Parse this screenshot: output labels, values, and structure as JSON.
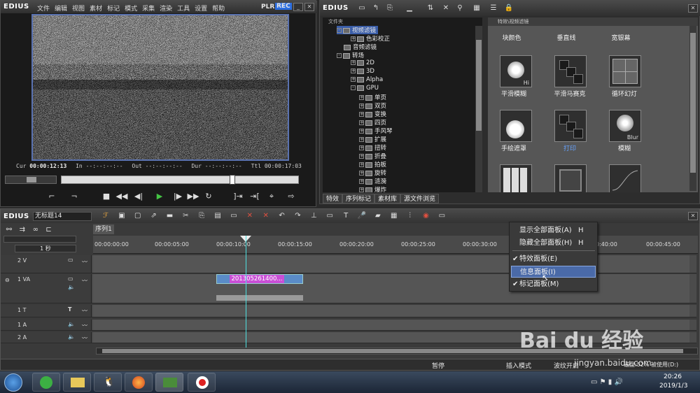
{
  "player": {
    "logo": "EDIUS",
    "menu": [
      "文件",
      "编辑",
      "视图",
      "素材",
      "标记",
      "模式",
      "采集",
      "渲染",
      "工具",
      "设置",
      "帮助"
    ],
    "plr": "PLR",
    "rec": "REC",
    "timecodes": {
      "cur_label": "Cur",
      "cur_value": "00:00:12:13",
      "in_label": "In",
      "in_value": "--:--:--:--",
      "out_label": "Out",
      "out_value": "--:--:--:--",
      "dur_label": "Dur",
      "dur_value": "--:--:--:--",
      "ttl_label": "Ttl",
      "ttl_value": "00:00:17:03"
    }
  },
  "library": {
    "logo": "EDIUS",
    "tree_header": "文件夹",
    "tree": [
      {
        "label": "视频滤镜",
        "level": 1,
        "selected": true
      },
      {
        "label": "色彩校正",
        "level": 2
      },
      {
        "label": "音频滤镜",
        "level": 1
      },
      {
        "label": "转场",
        "level": 1
      },
      {
        "label": "2D",
        "level": 2
      },
      {
        "label": "3D",
        "level": 2
      },
      {
        "label": "Alpha",
        "level": 2
      },
      {
        "label": "GPU",
        "level": 2
      },
      {
        "label": "单页",
        "level": 3
      },
      {
        "label": "双页",
        "level": 3
      },
      {
        "label": "变换",
        "level": 3
      },
      {
        "label": "四页",
        "level": 3
      },
      {
        "label": "手风琴",
        "level": 3
      },
      {
        "label": "扩展",
        "level": 3
      },
      {
        "label": "扭转",
        "level": 3
      },
      {
        "label": "折叠",
        "level": 3
      },
      {
        "label": "拍板",
        "level": 3
      },
      {
        "label": "旋转",
        "level": 3
      },
      {
        "label": "涟漪",
        "level": 3
      },
      {
        "label": "爆炸",
        "level": 3
      }
    ],
    "breadcrumb": "特效\\视频滤镜",
    "effects_top": [
      "块颜色",
      "垂直线",
      "宽银幕"
    ],
    "effects": [
      {
        "label": "平滑模糊",
        "badge": "Hi"
      },
      {
        "label": "平滑马赛克",
        "badge": ""
      },
      {
        "label": "循环幻灯",
        "badge": ""
      },
      {
        "label": "手绘遮罩",
        "badge": ""
      },
      {
        "label": "打印",
        "badge": ""
      },
      {
        "label": "模糊",
        "badge": "Blur"
      }
    ],
    "tabs": [
      "特效",
      "序列标记",
      "素材库",
      "源文件浏览"
    ]
  },
  "timeline": {
    "logo": "EDIUS",
    "project_name": "无标题14",
    "sequence_tab": "序列1",
    "scale": "1 秒",
    "ruler": [
      "00:00:00:00",
      "00:00:05:00",
      "00:00:10:00",
      "00:00:15:00",
      "00:00:20:00",
      "00:00:25:00",
      "00:00:30:00",
      "00:00:40:00",
      "00:00:45:00"
    ],
    "tracks": [
      {
        "name": "2 V"
      },
      {
        "name": "1 VA"
      },
      {
        "name": "1 T"
      },
      {
        "name": "1 A"
      },
      {
        "name": "2 A"
      }
    ],
    "clip_label": "201305261400...",
    "status": {
      "mode1": "暂停",
      "mode2": "插入模式",
      "mode3": "波纹开启",
      "disk": "磁盘:52% 被使用(D:)"
    }
  },
  "context_menu": [
    {
      "label": "显示全部面板(A)",
      "hotkey": "H",
      "checked": false
    },
    {
      "label": "隐藏全部面板(H)",
      "hotkey": "H",
      "checked": false
    },
    {
      "label": "特效面板(E)",
      "hotkey": "",
      "checked": true
    },
    {
      "label": "信息面板(I)",
      "hotkey": "",
      "checked": false,
      "hover": true
    },
    {
      "label": "标记面板(M)",
      "hotkey": "",
      "checked": true
    }
  ],
  "taskbar": {
    "time": "20:26",
    "date": "2019/1/3"
  },
  "watermark": {
    "brand": "Bai du 经验",
    "url": "jingyan.baidu.com"
  },
  "colors": {
    "rec": "#2b6de0",
    "clip": "#c94fd6",
    "playhead": "#4fe0e0",
    "accent": "#5a72b0"
  }
}
